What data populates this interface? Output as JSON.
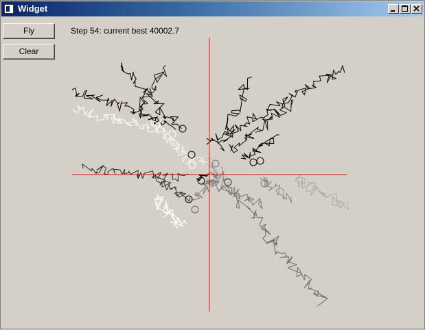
{
  "window": {
    "title": "Widget"
  },
  "buttons": {
    "fly_label": "Fly",
    "clear_label": "Clear"
  },
  "status": {
    "text": "Step 54: current best 40002.7"
  },
  "icons": {
    "app": "app-icon",
    "minimize": "minimize-icon",
    "maximize": "maximize-icon",
    "close": "close-icon"
  },
  "colors": {
    "axes": "#ff0000",
    "titlebar_start": "#0a246a",
    "titlebar_end": "#a6caf0",
    "background": "#d4d0c8"
  }
}
